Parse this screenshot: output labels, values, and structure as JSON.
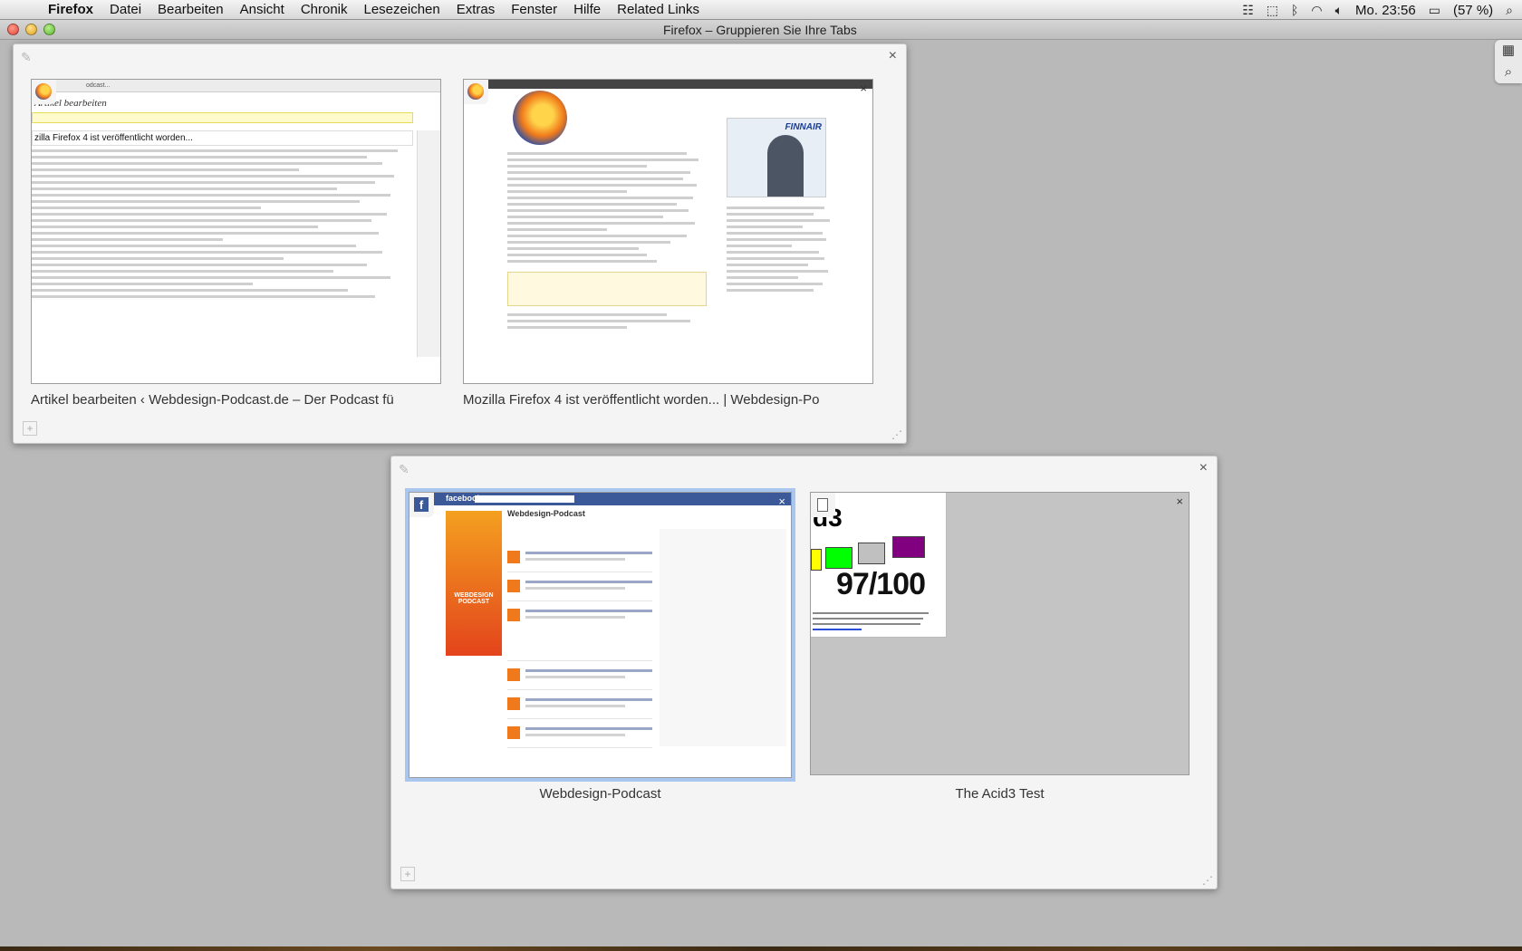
{
  "menubar": {
    "app": "Firefox",
    "items": [
      "Datei",
      "Bearbeiten",
      "Ansicht",
      "Chronik",
      "Lesezeichen",
      "Extras",
      "Fenster",
      "Hilfe",
      "Related Links"
    ],
    "clock": "Mo. 23:56",
    "battery": "(57 %)",
    "icons": [
      "apple-logo-icon",
      "tray-grid-icon",
      "screen-icon",
      "bluetooth-icon",
      "wifi-icon",
      "volume-icon",
      "battery-icon",
      "spotlight-icon"
    ]
  },
  "window": {
    "title": "Firefox – Gruppieren Sie Ihre Tabs"
  },
  "groups": [
    {
      "tabs": [
        {
          "title": "Artikel bearbeiten ‹ Webdesign-Podcast.de – Der Podcast fü",
          "favicon": "firefox-icon",
          "thumb": {
            "header": "Artikel bearbeiten",
            "topbar": "odcast...",
            "post_title": "zilla Firefox 4 ist veröffentlicht worden..."
          }
        },
        {
          "title": "Mozilla Firefox 4 ist veröffentlicht worden... | Webdesign-Po",
          "favicon": "firefox-icon",
          "thumb": {
            "ad_brand": "FINNAIR"
          }
        }
      ]
    },
    {
      "tabs": [
        {
          "title": "Webdesign-Podcast",
          "favicon": "facebook-icon",
          "active": true,
          "thumb": {
            "brand": "facebook",
            "page_title": "Webdesign-Podcast",
            "promo": "WEBDESIGN PODCAST"
          }
        },
        {
          "title": "The Acid3 Test",
          "favicon": "document-icon",
          "thumb": {
            "big": "d3",
            "score": "97/100"
          }
        }
      ]
    }
  ],
  "colors": {
    "active_ring": "#a8c6ee",
    "facebook_blue": "#3b5998",
    "firefox_orange": "#f07a1b"
  }
}
